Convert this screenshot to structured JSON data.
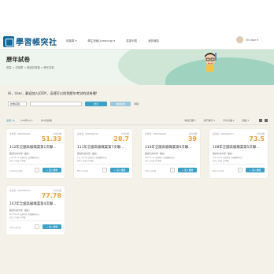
{
  "header": {
    "logo_text": "學習帳突社",
    "nav": [
      "試卷庫 ▾",
      "學生班級(Learning) ▾",
      "書架列表",
      "我的報告"
    ],
    "user_name": "Hi User ▾"
  },
  "hero": {
    "title": "歷年試卷",
    "breadcrumb": "首頁 > 試卷庫 > 歷屆試卷類 > 歷年試卷"
  },
  "search": {
    "greeting": "Hi，User，歡迎加入JODY，這裡可以找到歷年考試的試卷喔!",
    "filter_value": "試卷名稱",
    "placeholder": "",
    "search_label": "搜尋",
    "advanced_label": "進階篩選",
    "clear_label": "清除"
  },
  "filterbar": {
    "all": "全部 (5)",
    "year": "109年(5) ▾",
    "total": "共5份試卷",
    "sorts": [
      "考試日期 ▾",
      "熱門排行 ▾",
      "平均分數 ▾",
      "題數 ▾"
    ]
  },
  "cards": [
    {
      "tag": "試卷號：0000000342",
      "score_label": "平均分數",
      "score": "51.33",
      "title": "112年全國高級職業第1次聯…",
      "subject": "國文科(高中部・國文)",
      "meta1": "112.03.19 全國考區 全國聯模考試",
      "meta2": "高中三年級 共40題",
      "count": "1,002人已作答",
      "fav": "♡",
      "add": "+ 加入書櫃"
    },
    {
      "tag": "試卷號：0000000318",
      "score_label": "平均分數",
      "score": "28.7",
      "title": "111年全國高級職業第7次聯…",
      "subject": "國文科(高中部・國文)",
      "meta1": "111.12.25 全國考區 全國聯模考試",
      "meta2": "高中三年級 共40題",
      "count": "852人已作答",
      "fav": "♡",
      "add": "+ 加入書櫃"
    },
    {
      "tag": "試卷號：0000000290",
      "score_label": "平均分數",
      "score": "39",
      "title": "110年全國高級職業第6次聯…",
      "subject": "國文科(高中部・國文)",
      "meta1": "110.11.21 全國考區 全國聯模考試",
      "meta2": "高中三年級 共40題",
      "count": "716人已作答",
      "fav": "♡",
      "add": "+ 加入書櫃"
    },
    {
      "tag": "試卷號：0000000271",
      "score_label": "平均分數",
      "score": "73.5",
      "title": "108年全國高級職業第5次聯…",
      "subject": "國文科(高中部・國文)",
      "meta1": "108.10.20 全國考區 全國聯模考試",
      "meta2": "高中三年級 共40題",
      "count": "604人已作答",
      "fav": "♡",
      "add": "+ 加入書櫃"
    },
    {
      "tag": "試卷號：0000000255",
      "score_label": "平均分數",
      "score": "77.78",
      "title": "107年全國高級職業第4次聯…",
      "subject": "國文科(高中部・國文)",
      "meta1": "107.09.16 全國考區 全國聯模考試",
      "meta2": "高中三年級 共40題",
      "count": "520人已作答",
      "fav": "♡",
      "add": "+ 加入書櫃"
    }
  ]
}
